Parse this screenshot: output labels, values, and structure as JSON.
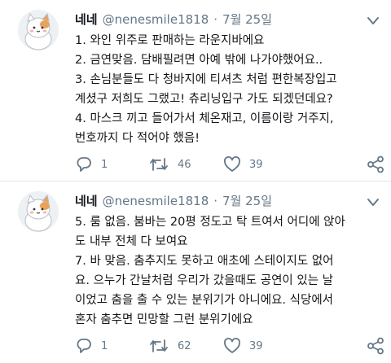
{
  "tweets": [
    {
      "display_name": "네네",
      "handle": "@nenesmile1818",
      "separator": "·",
      "date": "7월 25일",
      "lines": [
        "1. 와인 위주로 판매하는 라운지바에요",
        "2. 금연맞음. 담배필려면 아예 밖에 나가야했어요..",
        "3. 손님분들도 다 청바지에 티셔츠 처럼 편한복장입고",
        "계셨구 저희도 그랬고! 츄리닝입구 가도 되겠던데요?",
        "4. 마스크 끼고 들어가서 체온재고, 이름이랑 거주지,",
        "번호까지 다 적어야 했음!"
      ],
      "reply_count": "1",
      "retweet_count": "46",
      "like_count": "39"
    },
    {
      "display_name": "네네",
      "handle": "@nenesmile1818",
      "separator": "·",
      "date": "7월 25일",
      "lines": [
        "5. 룸 없음. 붐바는 20평 정도고 탁 트여서 어디에 앉아",
        "도 내부 전체 다 보여요",
        "7. 바 맞음. 춤추지도 못하고 애초에 스테이지도 없어",
        "요. 으누가 간날처럼 우리가 갔을때도 공연이 있는 날",
        "이었고 춤을 출 수 있는 분위기가 아니에요. 식당에서",
        "혼자 춤추면 민망할 그런 분위기에요"
      ],
      "reply_count": "1",
      "retweet_count": "62",
      "like_count": "39"
    }
  ],
  "icons": {
    "reply": "reply-icon",
    "retweet": "retweet-icon",
    "like": "heart-icon",
    "share": "share-icon",
    "menu": "chevron-down-icon"
  },
  "colors": {
    "text": "#14171a",
    "secondary": "#657786",
    "divider": "#e1e8ed"
  }
}
